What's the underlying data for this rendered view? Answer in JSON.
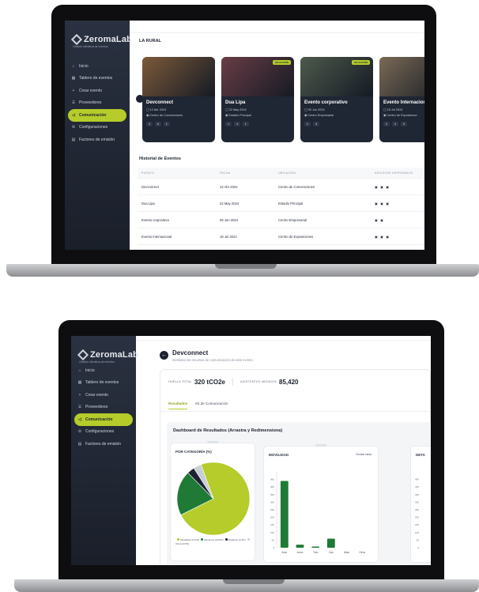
{
  "brand": {
    "name": "ZeromaLab",
    "tagline": "Gestión climática de eventos"
  },
  "nav": [
    {
      "label": "Inicio",
      "icon": "home-icon",
      "glyph": "⌂"
    },
    {
      "label": "Tablero de eventos",
      "icon": "dashboard-icon",
      "glyph": "▦"
    },
    {
      "label": "Crear evento",
      "icon": "plus-icon",
      "glyph": "+"
    },
    {
      "label": "Proveedores",
      "icon": "store-icon",
      "glyph": "⌸"
    },
    {
      "label": "Comunicación",
      "icon": "megaphone-icon",
      "glyph": "◁",
      "active": true
    },
    {
      "label": "Configuraciones",
      "icon": "gear-icon",
      "glyph": "⚙"
    },
    {
      "label": "Factores de emisión",
      "icon": "document-icon",
      "glyph": "▤"
    }
  ],
  "top": {
    "section_title": "LA RURAL",
    "cards": [
      {
        "name": "Devconnect",
        "date": "12 Abr 2024",
        "place": "Centro de Convenciones",
        "badge": "",
        "stats": [
          "2",
          "6",
          "1"
        ],
        "img": "#7d5a3a"
      },
      {
        "name": "Dua Lipa",
        "date": "22 May 2024",
        "place": "Estadio Principal",
        "badge": "EN ACCIÓN",
        "stats": [
          "1",
          "4",
          "1"
        ],
        "img": "#6a3d46"
      },
      {
        "name": "Evento corporativo",
        "date": "05 Jun 2024",
        "place": "Centro Empresarial",
        "badge": "EN ACCIÓN",
        "stats": [
          "1",
          "3"
        ],
        "img": "#4e5a4c"
      },
      {
        "name": "Evento Internaciona",
        "date": "18 Jul 2024",
        "place": "Centro de Exposicione",
        "badge": "EN ACCIÓN",
        "stats": [
          "2",
          "4",
          "3"
        ],
        "img": "#7a6a55"
      }
    ],
    "history_title": "Historial de Eventos",
    "history_headers": [
      "EVENTO",
      "FECHA",
      "UBICACIÓN",
      "ARCHIVOS DISPONIBLES"
    ],
    "history_rows": [
      {
        "event": "Devconnect",
        "date": "12 Abr 2024",
        "place": "Centro de Convenciones",
        "files": "▣ ▣ ▣"
      },
      {
        "event": "Dua Lipa",
        "date": "22 May 2024",
        "place": "Estadio Principal",
        "files": "▣ ▣ ▣"
      },
      {
        "event": "Evento corporativo",
        "date": "05 Jun 2024",
        "place": "Centro Empresarial",
        "files": "▣ ▣"
      },
      {
        "event": "Evento Internacional",
        "date": "18 Jul 2024",
        "place": "Centro de Exposiciones",
        "files": "▣ ▣ ▣"
      }
    ]
  },
  "bottom": {
    "event_title": "Devconnect",
    "event_subtitle": "Gestiona los recursos de comunicación de este evento",
    "metric_1_label": "HUELLA TOTAL",
    "metric_1_value": "320 tCO2e",
    "metric_2_label": "ASISTENTES MEDIDOS",
    "metric_2_value": "85,420",
    "tabs": [
      "Resultados",
      "Kit de Comunicación"
    ],
    "dashboard_title": "Dashboard de Resultados (Arrastra y Redimensiona)",
    "pie_widget_title": "POR CATEGORÍA (%)",
    "bar_widget_title": "MOVILIDAD",
    "bar_widget_link": "Ocultar tabla",
    "detail_widget_title": "DETA"
  },
  "colors": {
    "accent": "#b5cc2a",
    "sidebar": "#1f2634",
    "dark_green": "#1f7a35"
  },
  "chart_data": [
    {
      "type": "pie",
      "title": "POR CATEGORÍA (%)",
      "series": [
        {
          "name": "Movilidad (73.2%)",
          "value": 73.2,
          "color": "#b5cc2a"
        },
        {
          "name": "Alimentos (20.0%)",
          "value": 20.0,
          "color": "#1f7a35"
        },
        {
          "name": "Residuos (3.3%)",
          "value": 3.3,
          "color": "#1c2230"
        },
        {
          "name": "Otros (3.5%)",
          "value": 3.5,
          "color": "#c9ced6"
        }
      ]
    },
    {
      "type": "bar",
      "title": "MOVILIDAD",
      "categories": [
        "Auto",
        "Avión",
        "Tren",
        "Cas",
        "Moto",
        "Otros"
      ],
      "values": [
        440,
        20,
        8,
        60,
        0,
        0
      ],
      "ylim": [
        0,
        500
      ],
      "yticks": [
        0,
        50,
        100,
        150,
        200,
        250,
        300,
        350,
        400,
        450
      ]
    }
  ]
}
